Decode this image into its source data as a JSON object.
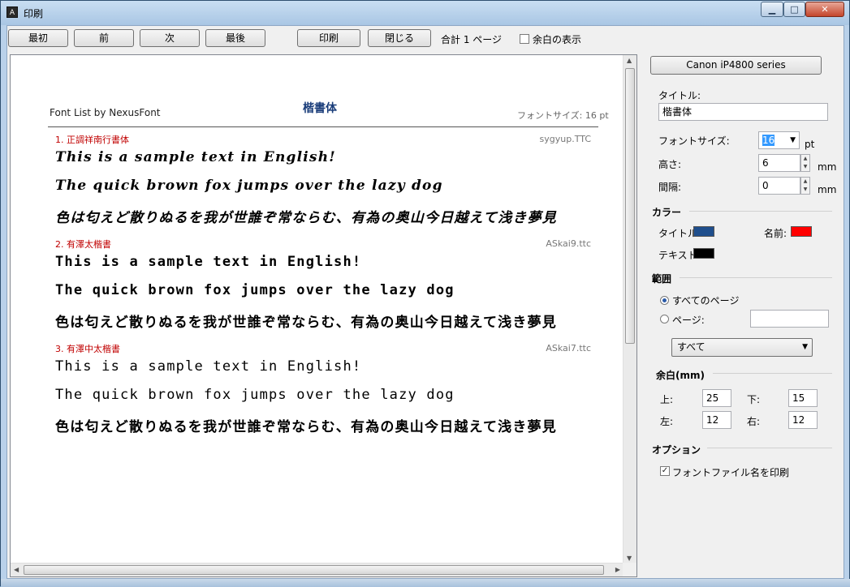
{
  "window": {
    "title": "印刷",
    "app_icon": "A",
    "min_icon": "minimize-icon",
    "max_icon": "maximize-icon",
    "close_icon": "close-icon"
  },
  "toolbar": {
    "first": "最初",
    "prev": "前",
    "next": "次",
    "last": "最後",
    "print": "印刷",
    "close": "閉じる",
    "page_count": "合計 1 ページ",
    "show_margin": "余白の表示",
    "show_margin_checked": false
  },
  "preview": {
    "header_left": "Font List by NexusFont",
    "header_title": "楷書体",
    "header_right": "フォントサイズ: 16 pt",
    "fonts": [
      {
        "name": "1. 正調祥南行書体",
        "file": "sygyup.TTC"
      },
      {
        "name": "2. 有澤太楷書",
        "file": "ASkai9.ttc"
      },
      {
        "name": "3. 有澤中太楷書",
        "file": "ASkai7.ttc"
      }
    ],
    "sample_en": "This is a sample text in English!",
    "sample_fox": "The quick brown fox jumps over the lazy dog",
    "sample_jp": "色は匂えど散りぬるを我が世誰ぞ常ならむ、有為の奥山今日越えて浅き夢見"
  },
  "settings": {
    "printer": "Canon iP4800 series",
    "title_label": "タイトル:",
    "title_value": "楷書体",
    "fontsize_label": "フォントサイズ:",
    "fontsize_value": "16",
    "fontsize_unit": "pt",
    "height_label": "高さ:",
    "height_value": "6",
    "height_unit": "mm",
    "spacing_label": "間隔:",
    "spacing_value": "0",
    "spacing_unit": "mm",
    "color_section": "カラー",
    "title_color_label": "タイトル:",
    "name_color_label": "名前:",
    "text_color_label": "テキスト:",
    "title_color": "#1f4e8c",
    "name_color": "#ff0000",
    "text_color": "#000000",
    "range_section": "範囲",
    "all_pages": "すべてのページ",
    "pages": "ページ:",
    "pages_value": "",
    "range_select": "すべて",
    "margin_section": "余白(mm)",
    "top_label": "上:",
    "top_value": "25",
    "bottom_label": "下:",
    "bottom_value": "15",
    "left_label": "左:",
    "left_value": "12",
    "right_label": "右:",
    "right_value": "12",
    "options_section": "オプション",
    "print_filename": "フォントファイル名を印刷",
    "print_filename_checked": true
  }
}
